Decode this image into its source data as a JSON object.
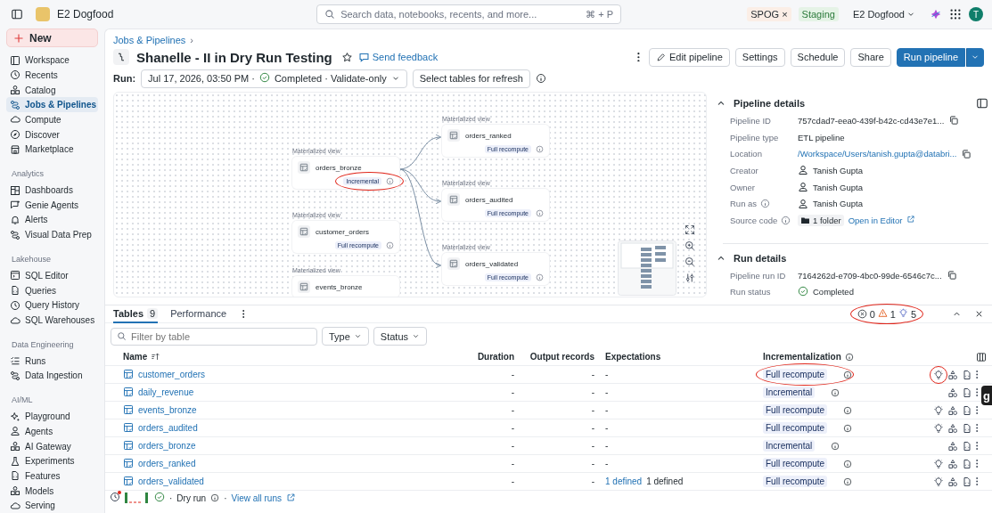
{
  "topbar": {
    "workspace": "E2 Dogfood",
    "search_placeholder": "Search data, notebooks, recents, and more...",
    "shortcut": "⌘ + P",
    "env_tag": "SPOG",
    "env_close": "×",
    "stage_tag": "Staging",
    "account": "E2 Dogfood",
    "avatar": "T"
  },
  "sidebar": {
    "new_label": "New",
    "sections": [
      {
        "items": [
          {
            "label": "Workspace",
            "selected": false
          },
          {
            "label": "Recents",
            "selected": false
          },
          {
            "label": "Catalog",
            "selected": false
          },
          {
            "label": "Jobs & Pipelines",
            "selected": true
          },
          {
            "label": "Compute",
            "selected": false
          },
          {
            "label": "Discover",
            "selected": false
          },
          {
            "label": "Marketplace",
            "selected": false
          }
        ]
      },
      {
        "title": "Analytics",
        "items": [
          {
            "label": "Dashboards",
            "selected": false
          },
          {
            "label": "Genie Agents",
            "selected": false
          },
          {
            "label": "Alerts",
            "selected": false
          },
          {
            "label": "Visual Data Prep",
            "selected": false
          }
        ]
      },
      {
        "title": "Lakehouse",
        "items": [
          {
            "label": "SQL Editor",
            "selected": false
          },
          {
            "label": "Queries",
            "selected": false
          },
          {
            "label": "Query History",
            "selected": false
          },
          {
            "label": "SQL Warehouses",
            "selected": false
          }
        ]
      },
      {
        "title": "Data Engineering",
        "items": [
          {
            "label": "Runs",
            "selected": false
          },
          {
            "label": "Data Ingestion",
            "selected": false
          }
        ]
      },
      {
        "title": "AI/ML",
        "items": [
          {
            "label": "Playground",
            "selected": false
          },
          {
            "label": "Agents",
            "selected": false
          },
          {
            "label": "AI Gateway",
            "selected": false
          },
          {
            "label": "Experiments",
            "selected": false
          },
          {
            "label": "Features",
            "selected": false
          },
          {
            "label": "Models",
            "selected": false
          },
          {
            "label": "Serving",
            "selected": false
          }
        ]
      }
    ]
  },
  "breadcrumb": {
    "link": "Jobs & Pipelines",
    "sep": "›"
  },
  "title": "Shanelle - II in Dry Run Testing",
  "feedback": "Send feedback",
  "actions": [
    "Edit pipeline",
    "Settings",
    "Schedule",
    "Share"
  ],
  "primary_action": "Run pipeline",
  "run": {
    "label": "Run:",
    "date": "Jul 17, 2026, 03:50 PM",
    "separator": "·",
    "status": "Completed",
    "mode": "Validate-only",
    "refresh_button": "Select tables for refresh"
  },
  "graph": {
    "nodes": [
      {
        "type": "Materialized view",
        "name": "orders_bronze",
        "mode": "Incremental",
        "circled": true
      },
      {
        "type": "Materialized view",
        "name": "customer_orders",
        "mode": "Full recompute",
        "circled": false
      },
      {
        "type": "Materialized view",
        "name": "events_bronze",
        "circled": false
      },
      {
        "type": "Materialized view",
        "name": "orders_ranked",
        "mode": "Full recompute",
        "circled": false
      },
      {
        "type": "Materialized view",
        "name": "orders_audited",
        "mode": "Full recompute",
        "circled": false
      },
      {
        "type": "Materialized view",
        "name": "orders_validated",
        "mode": "Full recompute",
        "circled": false
      }
    ]
  },
  "pipeline_details": {
    "title": "Pipeline details",
    "expanded": true,
    "rows": [
      {
        "label": "Pipeline ID",
        "value": "757cdad7-eea0-439f-b42c-cd43e7e1...",
        "kind": "copy",
        "info": false
      },
      {
        "label": "Pipeline type",
        "value": "ETL pipeline",
        "kind": "text",
        "info": false
      },
      {
        "label": "Location",
        "value": "/Workspace/Users/tanish.gupta@databri...",
        "kind": "link-copy",
        "info": false
      },
      {
        "label": "Creator",
        "value": "Tanish Gupta",
        "kind": "person",
        "info": false
      },
      {
        "label": "Owner",
        "value": "Tanish Gupta",
        "kind": "person",
        "info": false
      },
      {
        "label": "Run as",
        "value": "Tanish Gupta",
        "kind": "person",
        "info": true
      },
      {
        "label": "Source code",
        "value": "1 folder",
        "link": "Open in Editor",
        "kind": "source",
        "info": true
      }
    ]
  },
  "run_details": {
    "title": "Run details",
    "expanded": true,
    "rows": [
      {
        "label": "Pipeline run ID",
        "value": "7164262d-e709-4bc0-99de-6546c7c...",
        "kind": "copy",
        "info": false
      },
      {
        "label": "Run status",
        "value": "Completed",
        "kind": "status",
        "info": false
      }
    ]
  },
  "tabs": [
    {
      "label": "Tables",
      "count": "9",
      "selected": true
    },
    {
      "label": "Performance",
      "selected": false
    }
  ],
  "issues": {
    "errors": "0",
    "warnings": "1",
    "hints": "5",
    "circled": true
  },
  "filter": {
    "placeholder": "Filter by table",
    "dropdowns": [
      "Type",
      "Status"
    ]
  },
  "table": {
    "columns": [
      "Name",
      "Duration",
      "Output records",
      "Expectations",
      "Incrementalization"
    ],
    "rows": [
      {
        "name": "customer_orders",
        "duration": "-",
        "output": "-",
        "expectations": "-",
        "mode": "Full recompute",
        "hint": true,
        "mode_circled": true,
        "hint_circled": true
      },
      {
        "name": "daily_revenue",
        "duration": "-",
        "output": "-",
        "expectations": "-",
        "mode": "Incremental",
        "hint": false,
        "mode_circled": false,
        "hint_circled": false
      },
      {
        "name": "events_bronze",
        "duration": "-",
        "output": "-",
        "expectations": "-",
        "mode": "Full recompute",
        "hint": true,
        "mode_circled": false,
        "hint_circled": false
      },
      {
        "name": "orders_audited",
        "duration": "-",
        "output": "-",
        "expectations": "-",
        "mode": "Full recompute",
        "hint": true,
        "mode_circled": false,
        "hint_circled": false
      },
      {
        "name": "orders_bronze",
        "duration": "-",
        "output": "-",
        "expectations": "-",
        "mode": "Incremental",
        "hint": false,
        "mode_circled": false,
        "hint_circled": false
      },
      {
        "name": "orders_ranked",
        "duration": "-",
        "output": "-",
        "expectations": "-",
        "mode": "Full recompute",
        "hint": true,
        "mode_circled": false,
        "hint_circled": false
      },
      {
        "name": "orders_validated",
        "duration": "-",
        "output": "-",
        "expectations_link": "1 defined",
        "expectations": "1 defined",
        "mode": "Full recompute",
        "hint": true,
        "mode_circled": false,
        "hint_circled": false
      }
    ]
  },
  "footer": {
    "separator": "·",
    "mode": "Dry run",
    "link": "View all runs"
  },
  "widget_tab": "g"
}
